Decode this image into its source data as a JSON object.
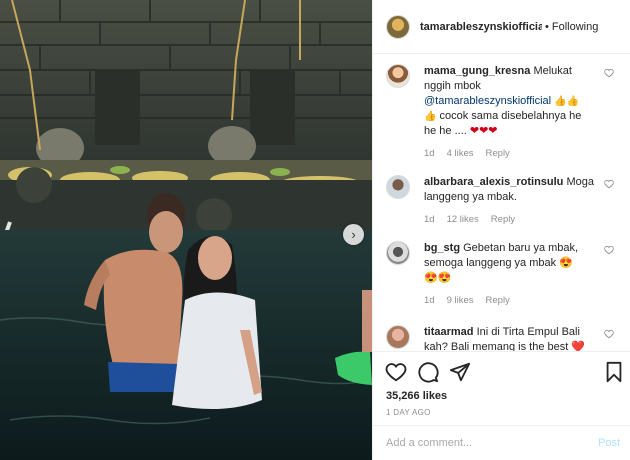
{
  "post": {
    "username": "tamarableszynskiofficial",
    "follow_status": "Following",
    "dot": "•",
    "likes": "35,266 likes",
    "date": "1 DAY AGO",
    "add_comment_placeholder": "Add a comment...",
    "post_label": "Post"
  },
  "comments": [
    {
      "username": "mama_gung_kresna",
      "text_a": "Melukat nggih mbok",
      "mention": "@tamarableszynskiofficial",
      "emoji_a": "👍👍",
      "emoji_b": "👍",
      "text_b": "cocok sama disebelahnya he he he ....",
      "emoji_c": "❤❤❤",
      "time": "1d",
      "likes": "4 likes",
      "reply": "Reply"
    },
    {
      "username": "albarbara_alexis_rotinsulu",
      "text_a": "Moga langgeng ya mbak.",
      "time": "1d",
      "likes": "12 likes",
      "reply": "Reply"
    },
    {
      "username": "bg_stg",
      "text_a": "Gebetan baru ya mbak, semoga langgeng ya mbak",
      "emoji_a": "😍",
      "emoji_b": "😍😍",
      "time": "1d",
      "likes": "9 likes",
      "reply": "Reply"
    },
    {
      "username": "titaarmad",
      "text_a": "Ini di Tirta Empul Bali kah? Bali memang is the best",
      "emoji_a": "❤️"
    }
  ],
  "colors": {
    "link": "#00376b",
    "muted": "#8e8e8e",
    "post_button": "#b2dffc",
    "heart_red": "#d0021b"
  },
  "icons": [
    "heart-icon",
    "comment-icon",
    "share-icon",
    "bookmark-icon",
    "chevron-right-icon"
  ]
}
